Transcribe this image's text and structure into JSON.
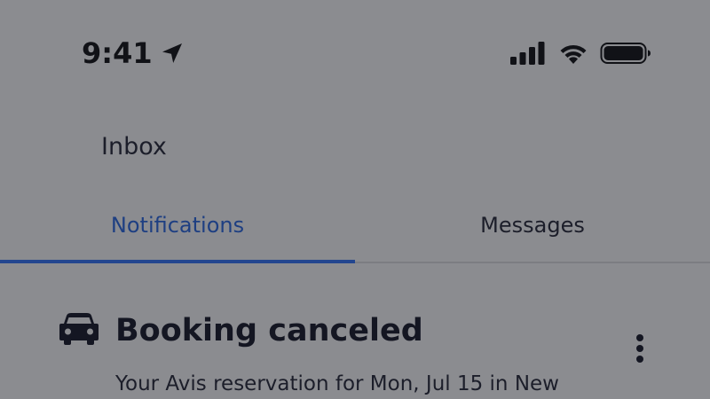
{
  "status_bar": {
    "time": "9:41",
    "icons": [
      "location-arrow-icon",
      "cellular-signal-icon",
      "wifi-icon",
      "battery-icon"
    ]
  },
  "header": {
    "title": "Inbox"
  },
  "tabs": [
    {
      "label": "Notifications",
      "active": true
    },
    {
      "label": "Messages",
      "active": false
    }
  ],
  "notification": {
    "icon": "car-icon",
    "title": "Booking canceled",
    "body": "Your Avis reservation for Mon, Jul 15 in New"
  },
  "colors": {
    "background": "#8b8c90",
    "accent": "#23468f",
    "text": "#1b1d29"
  }
}
